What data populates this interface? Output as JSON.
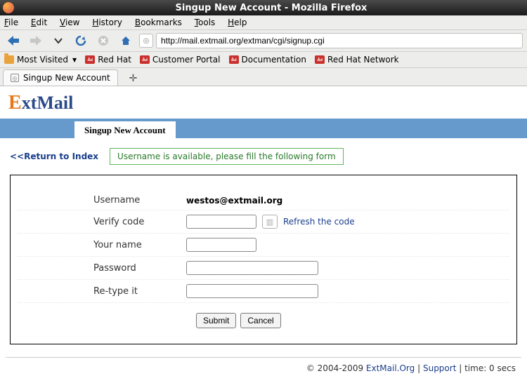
{
  "window": {
    "title": "Singup New Account - Mozilla Firefox"
  },
  "menu": {
    "file": "File",
    "edit": "Edit",
    "view": "View",
    "history": "History",
    "bookmarks": "Bookmarks",
    "tools": "Tools",
    "help": "Help"
  },
  "toolbar": {
    "url": "http://mail.extmail.org/extman/cgi/signup.cgi"
  },
  "bookmarks": {
    "most_visited": "Most Visited",
    "items": [
      {
        "label": "Red Hat"
      },
      {
        "label": "Customer Portal"
      },
      {
        "label": "Documentation"
      },
      {
        "label": "Red Hat Network"
      }
    ]
  },
  "tab": {
    "title": "Singup New Account"
  },
  "logo": {
    "part1": "E",
    "part2": "xtMail"
  },
  "heading": "Singup New Account",
  "return_link": "<<Return to Index",
  "status_msg": "Username is available, please fill the following form",
  "form": {
    "username_label": "Username",
    "username_value": "westos@extmail.org",
    "verify_label": "Verify code",
    "refresh_label": "Refresh the code",
    "name_label": "Your name",
    "password_label": "Password",
    "retype_label": "Re-type it",
    "submit": "Submit",
    "cancel": "Cancel"
  },
  "footer": {
    "copyright": "© 2004-2009 ",
    "link1": "ExtMail.Org",
    "link2": "Support",
    "time": " | time: 0 secs"
  }
}
